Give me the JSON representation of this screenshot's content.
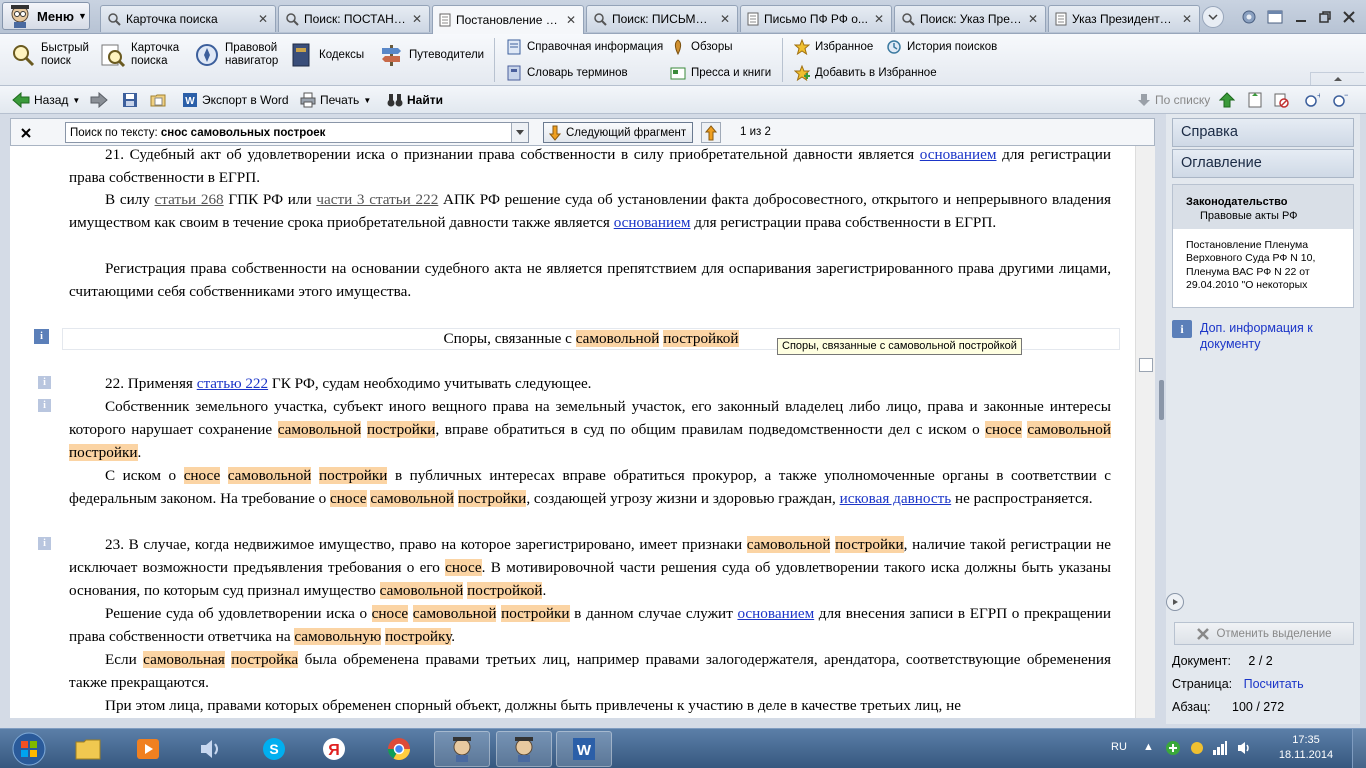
{
  "menu": {
    "label": "Меню"
  },
  "tabs": [
    {
      "label": "Карточка поиска"
    },
    {
      "label": "Поиск: ПОСТАНО..."
    },
    {
      "label": "Постановление П..."
    },
    {
      "label": "Поиск: ПИСЬМО, ..."
    },
    {
      "label": "Письмо ПФ РФ о..."
    },
    {
      "label": "Поиск: Указ През..."
    },
    {
      "label": "Указ Президента ..."
    }
  ],
  "toolbar": {
    "quick_search": "Быстрый\nпоиск",
    "search_card": "Карточка\nпоиска",
    "legal_navigator": "Правовой\nнавигатор",
    "codes": "Кодексы",
    "guides": "Путеводители",
    "reference_info": "Справочная информация",
    "reviews": "Обзоры",
    "favorites": "Избранное",
    "search_history": "История поисков",
    "glossary": "Словарь терминов",
    "press_books": "Пресса и книги",
    "add_favorites": "Добавить в Избранное"
  },
  "navbar": {
    "back": "Назад",
    "export_word": "Экспорт в Word",
    "print": "Печать",
    "find": "Найти",
    "by_list": "По списку"
  },
  "searchbar": {
    "label": "Поиск по тексту:",
    "query": "снос самовольных построек",
    "next_fragment": "Следующий фрагмент",
    "counter": "1 из 2"
  },
  "document": {
    "p1": {
      "t1": "21. Судебный акт об удовлетворении иска о признании права собственности в силу приобретательной давности является ",
      "l1": "основанием",
      "t2": " для регистрации права собственности в ЕГРП."
    },
    "p2": {
      "t1": "В силу ",
      "l1": "статьи 268",
      "t2": " ГПК РФ или ",
      "l2": "части 3 статьи 222",
      "t3": " АПК РФ решение суда об установлении факта добросовестного, открытого и непрерывного владения имуществом как своим в течение срока приобретательной давности также является ",
      "l3": "основанием",
      "t4": " для регистрации права собственности в ЕГРП."
    },
    "p3": "Регистрация права собственности на основании судебного акта не является препятствием для оспаривания зарегистрированного права другими лицами, считающими себя собственниками этого имущества.",
    "section_heading": {
      "t1": "Споры, связанные с ",
      "h1": "самовольной",
      "h2": "постройкой"
    },
    "tooltip": "Споры, связанные с самовольной постройкой",
    "p4": {
      "t1": "22. Применяя ",
      "l1": "статью 222",
      "t2": " ГК РФ, судам необходимо учитывать следующее."
    },
    "p5": {
      "t1": "Собственник земельного участка, субъект иного вещного права на земельный участок, его законный владелец либо лицо, права и законные интересы которого нарушает сохранение ",
      "h1": "самовольной",
      "h2": "постройки",
      "t2": ", вправе обратиться в суд по общим правилам подведомственности дел с иском о ",
      "h3": "сносе",
      "h4": "самовольной",
      "h5": "постройки",
      "t3": "."
    },
    "p6": {
      "t1": "С иском о ",
      "h1": "сносе",
      "h2": "самовольной",
      "h3": "постройки",
      "t2": " в публичных интересах вправе обратиться прокурор, а также уполномоченные органы в соответствии с федеральным законом. На требование о ",
      "h4": "сносе",
      "h5": "самовольной",
      "h6": "постройки",
      "t3": ", создающей угрозу жизни и здоровью граждан, ",
      "l1": "исковая давность",
      "t4": " не распространяется."
    },
    "p7": {
      "t1": "23. В случае, когда недвижимое имущество, право на которое зарегистрировано, имеет признаки ",
      "h1": "самовольной",
      "h2": "постройки",
      "t2": ", наличие такой регистрации не исключает возможности предъявления требования о его ",
      "h3": "сносе",
      "t3": ". В мотивировочной части решения суда об удовлетворении такого иска должны быть указаны основания, по которым суд признал имущество ",
      "h4": "самовольной",
      "h5": "постройкой",
      "t4": "."
    },
    "p8": {
      "t1": "Решение суда об удовлетворении иска о ",
      "h1": "сносе",
      "h2": "самовольной",
      "h3": "постройки",
      "t2": " в данном случае служит ",
      "l1": "основанием",
      "t3": " для внесения записи в ЕГРП о прекращении права собственности ответчика на ",
      "h4": "самовольную",
      "h5": "постройку",
      "t4": "."
    },
    "p9": {
      "t1": "Если ",
      "h1": "самовольная",
      "h2": "постройка",
      "t2": " была обременена правами третьих лиц, например правами залогодержателя, арендатора, соответствующие обременения также прекращаются."
    },
    "p10": "При этом лица, правами которых обременен спорный объект, должны быть привлечены к участию в деле в качестве третьих лиц, не"
  },
  "right_panel": {
    "help": "Справка",
    "toc": "Оглавление",
    "legislation": "Законодательство",
    "legal_acts": "Правовые акты РФ",
    "doc_title": "Постановление Пленума Верховного Суда РФ N 10, Пленума ВАС РФ N 22 от 29.04.2010 \"О некоторых",
    "extra_info": "Доп. информация к документу",
    "unselect": "Отменить выделение",
    "doc_label": "Документ:",
    "doc_value": "2 / 2",
    "page_label": "Страница:",
    "page_value": "Посчитать",
    "para_label": "Абзац:",
    "para_value": "100 / 272"
  },
  "taskbar": {
    "lang": "RU",
    "time": "17:35",
    "date": "18.11.2014"
  },
  "colors": {
    "highlight": "#fbd4a4",
    "link": "#1b35c8",
    "taskbar": "#3c5f88"
  }
}
